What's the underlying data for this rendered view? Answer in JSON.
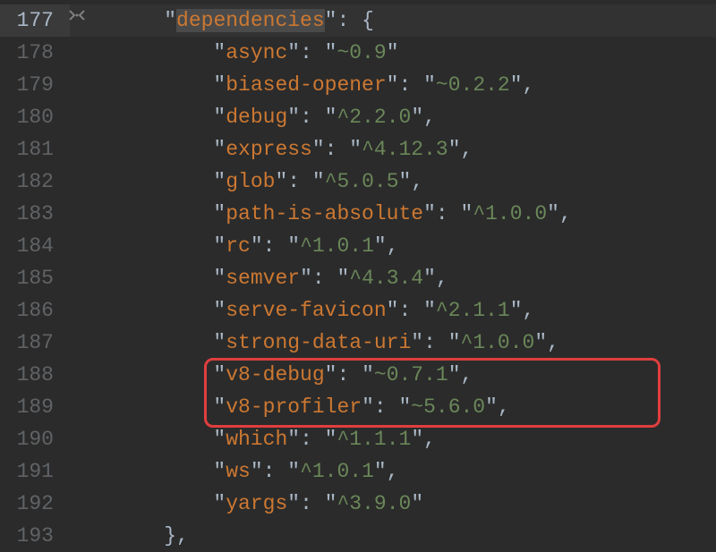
{
  "lines": [
    {
      "num": 177,
      "active": true,
      "indent": "  ",
      "key": "dependencies",
      "value": null,
      "open": true,
      "close": false,
      "comma": false,
      "highlight_key": true
    },
    {
      "num": 178,
      "active": false,
      "indent": "    ",
      "key": "async",
      "value": "~0.9",
      "open": false,
      "close": false,
      "comma": false,
      "highlight_key": false
    },
    {
      "num": 179,
      "active": false,
      "indent": "    ",
      "key": "biased-opener",
      "value": "~0.2.2",
      "open": false,
      "close": false,
      "comma": true,
      "highlight_key": false
    },
    {
      "num": 180,
      "active": false,
      "indent": "    ",
      "key": "debug",
      "value": "^2.2.0",
      "open": false,
      "close": false,
      "comma": true,
      "highlight_key": false
    },
    {
      "num": 181,
      "active": false,
      "indent": "    ",
      "key": "express",
      "value": "^4.12.3",
      "open": false,
      "close": false,
      "comma": true,
      "highlight_key": false
    },
    {
      "num": 182,
      "active": false,
      "indent": "    ",
      "key": "glob",
      "value": "^5.0.5",
      "open": false,
      "close": false,
      "comma": true,
      "highlight_key": false
    },
    {
      "num": 183,
      "active": false,
      "indent": "    ",
      "key": "path-is-absolute",
      "value": "^1.0.0",
      "open": false,
      "close": false,
      "comma": true,
      "highlight_key": false
    },
    {
      "num": 184,
      "active": false,
      "indent": "    ",
      "key": "rc",
      "value": "^1.0.1",
      "open": false,
      "close": false,
      "comma": true,
      "highlight_key": false
    },
    {
      "num": 185,
      "active": false,
      "indent": "    ",
      "key": "semver",
      "value": "^4.3.4",
      "open": false,
      "close": false,
      "comma": true,
      "highlight_key": false
    },
    {
      "num": 186,
      "active": false,
      "indent": "    ",
      "key": "serve-favicon",
      "value": "^2.1.1",
      "open": false,
      "close": false,
      "comma": true,
      "highlight_key": false
    },
    {
      "num": 187,
      "active": false,
      "indent": "    ",
      "key": "strong-data-uri",
      "value": "^1.0.0",
      "open": false,
      "close": false,
      "comma": true,
      "highlight_key": false
    },
    {
      "num": 188,
      "active": false,
      "indent": "    ",
      "key": "v8-debug",
      "value": "~0.7.1",
      "open": false,
      "close": false,
      "comma": true,
      "highlight_key": false
    },
    {
      "num": 189,
      "active": false,
      "indent": "    ",
      "key": "v8-profiler",
      "value": "~5.6.0",
      "open": false,
      "close": false,
      "comma": true,
      "highlight_key": false
    },
    {
      "num": 190,
      "active": false,
      "indent": "    ",
      "key": "which",
      "value": "^1.1.1",
      "open": false,
      "close": false,
      "comma": true,
      "highlight_key": false
    },
    {
      "num": 191,
      "active": false,
      "indent": "    ",
      "key": "ws",
      "value": "^1.0.1",
      "open": false,
      "close": false,
      "comma": true,
      "highlight_key": false
    },
    {
      "num": 192,
      "active": false,
      "indent": "    ",
      "key": "yargs",
      "value": "^3.9.0",
      "open": false,
      "close": false,
      "comma": false,
      "highlight_key": false
    },
    {
      "num": 193,
      "active": false,
      "indent": "  ",
      "key": null,
      "value": null,
      "open": false,
      "close": true,
      "comma": true,
      "highlight_key": false
    }
  ]
}
